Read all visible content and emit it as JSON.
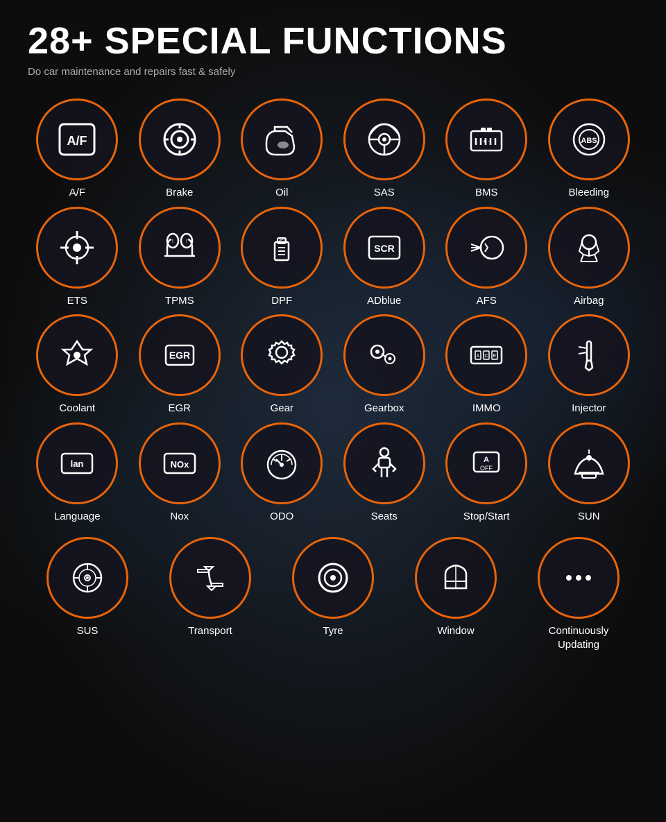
{
  "header": {
    "title": "28+ SPECIAL FUNCTIONS",
    "subtitle": "Do car maintenance and repairs  fast & safely"
  },
  "rows": [
    [
      {
        "label": "A/F",
        "icon": "af"
      },
      {
        "label": "Brake",
        "icon": "brake"
      },
      {
        "label": "Oil",
        "icon": "oil"
      },
      {
        "label": "SAS",
        "icon": "sas"
      },
      {
        "label": "BMS",
        "icon": "bms"
      },
      {
        "label": "Bleeding",
        "icon": "bleeding"
      }
    ],
    [
      {
        "label": "ETS",
        "icon": "ets"
      },
      {
        "label": "TPMS",
        "icon": "tpms"
      },
      {
        "label": "DPF",
        "icon": "dpf"
      },
      {
        "label": "ADblue",
        "icon": "adblue"
      },
      {
        "label": "AFS",
        "icon": "afs"
      },
      {
        "label": "Airbag",
        "icon": "airbag"
      }
    ],
    [
      {
        "label": "Coolant",
        "icon": "coolant"
      },
      {
        "label": "EGR",
        "icon": "egr"
      },
      {
        "label": "Gear",
        "icon": "gear"
      },
      {
        "label": "Gearbox",
        "icon": "gearbox"
      },
      {
        "label": "IMMO",
        "icon": "immo"
      },
      {
        "label": "Injector",
        "icon": "injector"
      }
    ],
    [
      {
        "label": "Language",
        "icon": "language"
      },
      {
        "label": "Nox",
        "icon": "nox"
      },
      {
        "label": "ODO",
        "icon": "odo"
      },
      {
        "label": "Seats",
        "icon": "seats"
      },
      {
        "label": "Stop/Start",
        "icon": "stopstart"
      },
      {
        "label": "SUN",
        "icon": "sun"
      }
    ],
    [
      {
        "label": "SUS",
        "icon": "sus"
      },
      {
        "label": "Transport",
        "icon": "transport"
      },
      {
        "label": "Tyre",
        "icon": "tyre"
      },
      {
        "label": "Window",
        "icon": "window"
      },
      {
        "label": "Continuously\nUpdating",
        "icon": "more"
      }
    ]
  ]
}
